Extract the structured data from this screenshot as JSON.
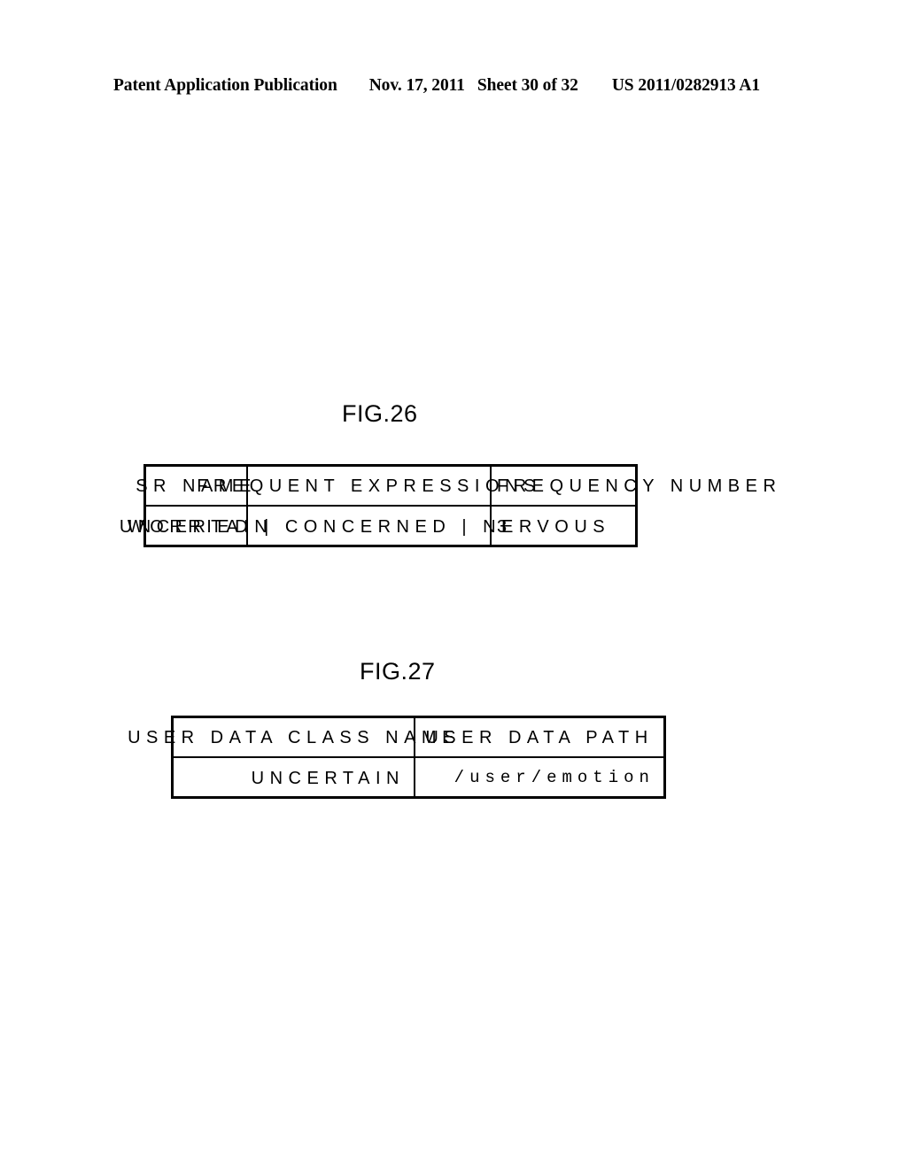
{
  "page_header": {
    "publication": "Patent Application Publication",
    "date": "Nov. 17, 2011",
    "sheet": "Sheet 30 of 32",
    "patent_number": "US 2011/0282913 A1"
  },
  "figures": [
    {
      "title": "FIG.26",
      "table": {
        "headers": [
          "SR NAME",
          "FREQUENT EXPRESSIONS",
          "FREQUENCY NUMBER"
        ],
        "rows": [
          [
            "UNCERTAIN",
            "WORRIED | CONCERNED | NERVOUS",
            "3"
          ]
        ]
      }
    },
    {
      "title": "FIG.27",
      "table": {
        "headers": [
          "USER DATA CLASS NAME",
          "USER DATA PATH"
        ],
        "rows": [
          [
            "UNCERTAIN",
            "/user/emotion"
          ]
        ]
      }
    }
  ]
}
